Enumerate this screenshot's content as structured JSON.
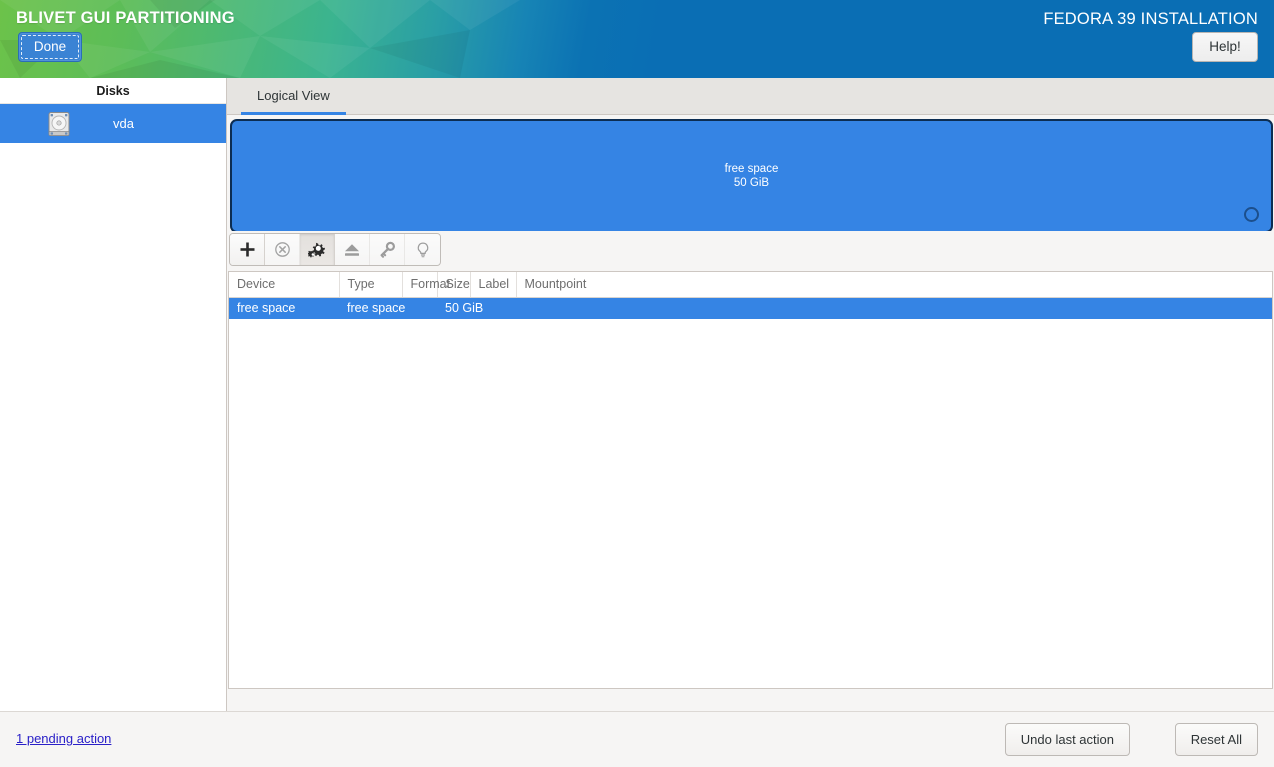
{
  "header": {
    "title": "BLIVET GUI PARTITIONING",
    "done_label": "Done",
    "install_label": "FEDORA 39 INSTALLATION",
    "help_label": "Help!",
    "gradient_start": "#6cc24a",
    "gradient_mid": "#2a9fa5",
    "gradient_end": "#0a6eb4",
    "accent_color": "#3584e4"
  },
  "sidebar": {
    "heading": "Disks",
    "disks": [
      {
        "name": "vda",
        "icon": "hard-drive-icon",
        "selected": true
      }
    ]
  },
  "main": {
    "tabs": [
      {
        "label": "Logical View",
        "active": true
      }
    ],
    "visualization": {
      "blocks": [
        {
          "name": "free space",
          "size": "50 GiB",
          "color": "#3584e4",
          "border_color": "#0c2d52",
          "selected": true,
          "has_resize_grip": true
        }
      ]
    },
    "toolbar": [
      {
        "name": "add-partition-button",
        "icon": "plus-icon",
        "tooltip": "Add",
        "state": "normal"
      },
      {
        "name": "delete-partition-button",
        "icon": "circle-x-icon",
        "tooltip": "Delete",
        "state": "disabled"
      },
      {
        "name": "edit-partition-button",
        "icon": "gears-icon",
        "tooltip": "Edit",
        "state": "pressed"
      },
      {
        "name": "unmount-button",
        "icon": "eject-icon",
        "tooltip": "Unmount",
        "state": "disabled"
      },
      {
        "name": "decrypt-button",
        "icon": "key-icon",
        "tooltip": "Decrypt",
        "state": "disabled"
      },
      {
        "name": "info-button",
        "icon": "lightbulb-icon",
        "tooltip": "Info",
        "state": "disabled"
      }
    ],
    "table": {
      "columns": [
        "Device",
        "Type",
        "Format",
        "Size",
        "Label",
        "Mountpoint"
      ],
      "rows": [
        {
          "selected": true,
          "cells": {
            "device": "free space",
            "type": "free space",
            "format": "",
            "size": "50 GiB",
            "label": "",
            "mountpoint": ""
          }
        }
      ]
    }
  },
  "footer": {
    "pending_actions": "1 pending action",
    "undo_label": "Undo last action",
    "reset_label": "Reset All"
  }
}
